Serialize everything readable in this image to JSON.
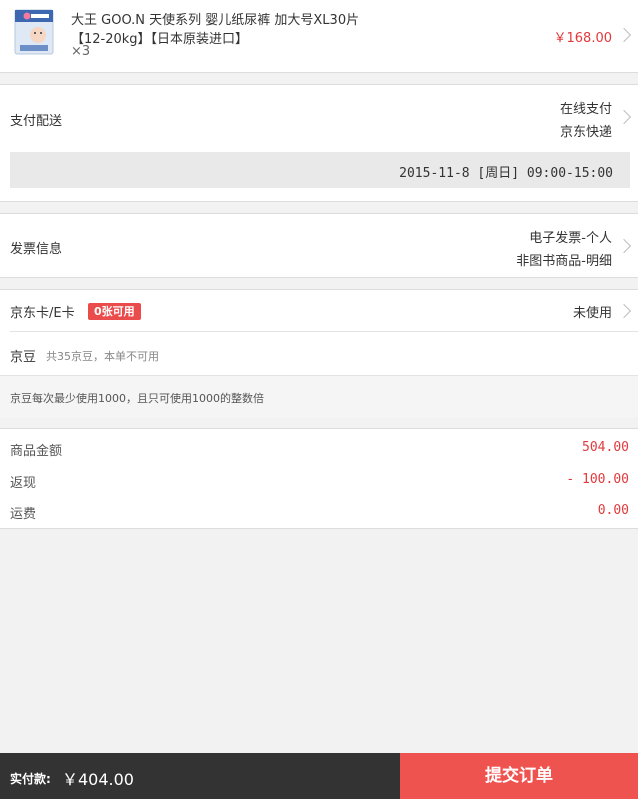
{
  "product": {
    "title": "大王 GOO.N 天使系列 婴儿纸尿裤 加大号XL30片",
    "spec": "【12-20kg】【日本原装进口】",
    "quantity": "×3",
    "price": "￥168.00",
    "thumb_icon": "diaper-package-icon"
  },
  "payment": {
    "label": "支付配送",
    "method": "在线支付",
    "courier": "京东快递",
    "delivery_time": "2015-11-8 [周日] 09:00-15:00"
  },
  "invoice": {
    "label": "发票信息",
    "type": "电子发票-个人",
    "content": "非图书商品-明细"
  },
  "card": {
    "label": "京东卡/E卡",
    "badge": "0张可用",
    "status": "未使用"
  },
  "beans": {
    "label": "京豆",
    "note": "共35京豆，本单不可用",
    "rule": "京豆每次最少使用1000，且只可使用1000的整数倍"
  },
  "summary": {
    "goods_label": "商品金额",
    "goods_value": "504.00",
    "cashback_label": "返现",
    "cashback_value": "- 100.00",
    "shipping_label": "运费",
    "shipping_value": "0.00"
  },
  "bottom": {
    "pay_label": "实付款:",
    "pay_amount": "￥404.00",
    "submit_label": "提交订单"
  },
  "colors": {
    "accent": "#e4393c",
    "submit_bg": "#ef5350",
    "bar_bg": "#333333",
    "badge_bg": "#ea4c4c"
  }
}
